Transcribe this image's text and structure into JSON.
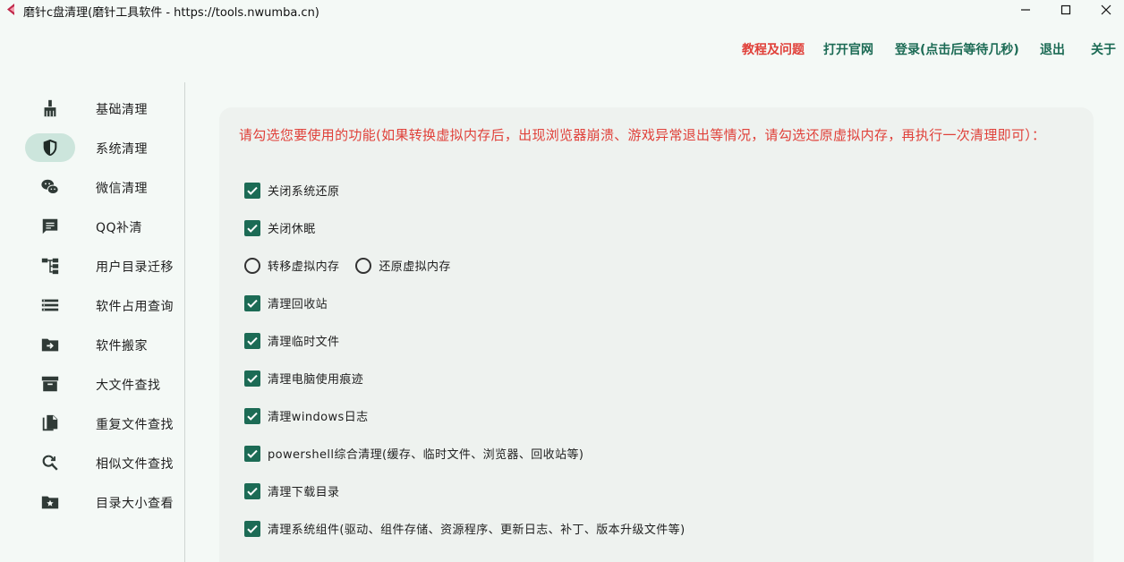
{
  "window": {
    "title": "磨针c盘清理(磨针工具软件 - https://tools.nwumba.cn)"
  },
  "topnav": {
    "help": "教程及问题",
    "site": "打开官网",
    "login": "登录(点击后等待几秒)",
    "exit": "退出",
    "about": "关于"
  },
  "sidebar": {
    "items": [
      {
        "label": "基础清理",
        "icon": "broom-icon",
        "active": false
      },
      {
        "label": "系统清理",
        "icon": "shield-icon",
        "active": true
      },
      {
        "label": "微信清理",
        "icon": "wechat-icon",
        "active": false
      },
      {
        "label": "QQ补清",
        "icon": "chat-icon",
        "active": false
      },
      {
        "label": "用户目录迁移",
        "icon": "tree-icon",
        "active": false
      },
      {
        "label": "软件占用查询",
        "icon": "list-icon",
        "active": false
      },
      {
        "label": "软件搬家",
        "icon": "folder-move-icon",
        "active": false
      },
      {
        "label": "大文件查找",
        "icon": "archive-icon",
        "active": false
      },
      {
        "label": "重复文件查找",
        "icon": "copy-file-icon",
        "active": false
      },
      {
        "label": "相似文件查找",
        "icon": "search-refresh-icon",
        "active": false
      },
      {
        "label": "目录大小查看",
        "icon": "folder-star-icon",
        "active": false
      }
    ]
  },
  "main": {
    "prompt": "请勾选您要使用的功能(如果转换虚拟内存后，出现浏览器崩溃、游戏异常退出等情况，请勾选还原虚拟内存，再执行一次清理即可）：",
    "options": [
      {
        "label": "关闭系统还原",
        "checked": true
      },
      {
        "label": "关闭休眠",
        "checked": true
      },
      {
        "label": "清理回收站",
        "checked": true
      },
      {
        "label": "清理临时文件",
        "checked": true
      },
      {
        "label": "清理电脑使用痕迹",
        "checked": true
      },
      {
        "label": "清理windows日志",
        "checked": true
      },
      {
        "label": "powershell综合清理(缓存、临时文件、浏览器、回收站等)",
        "checked": true
      },
      {
        "label": "清理下载目录",
        "checked": true
      },
      {
        "label": "清理系统组件(驱动、组件存储、资源程序、更新日志、补丁、版本升级文件等)",
        "checked": true
      }
    ],
    "radios": [
      {
        "label": "转移虚拟内存",
        "selected": false
      },
      {
        "label": "还原虚拟内存",
        "selected": false
      }
    ]
  },
  "colors": {
    "accent": "#1c6b55",
    "warning": "#e0413a",
    "active_bg": "#cce5dc",
    "panel_bg": "#eef2ef",
    "page_bg": "#f4f9f6"
  }
}
